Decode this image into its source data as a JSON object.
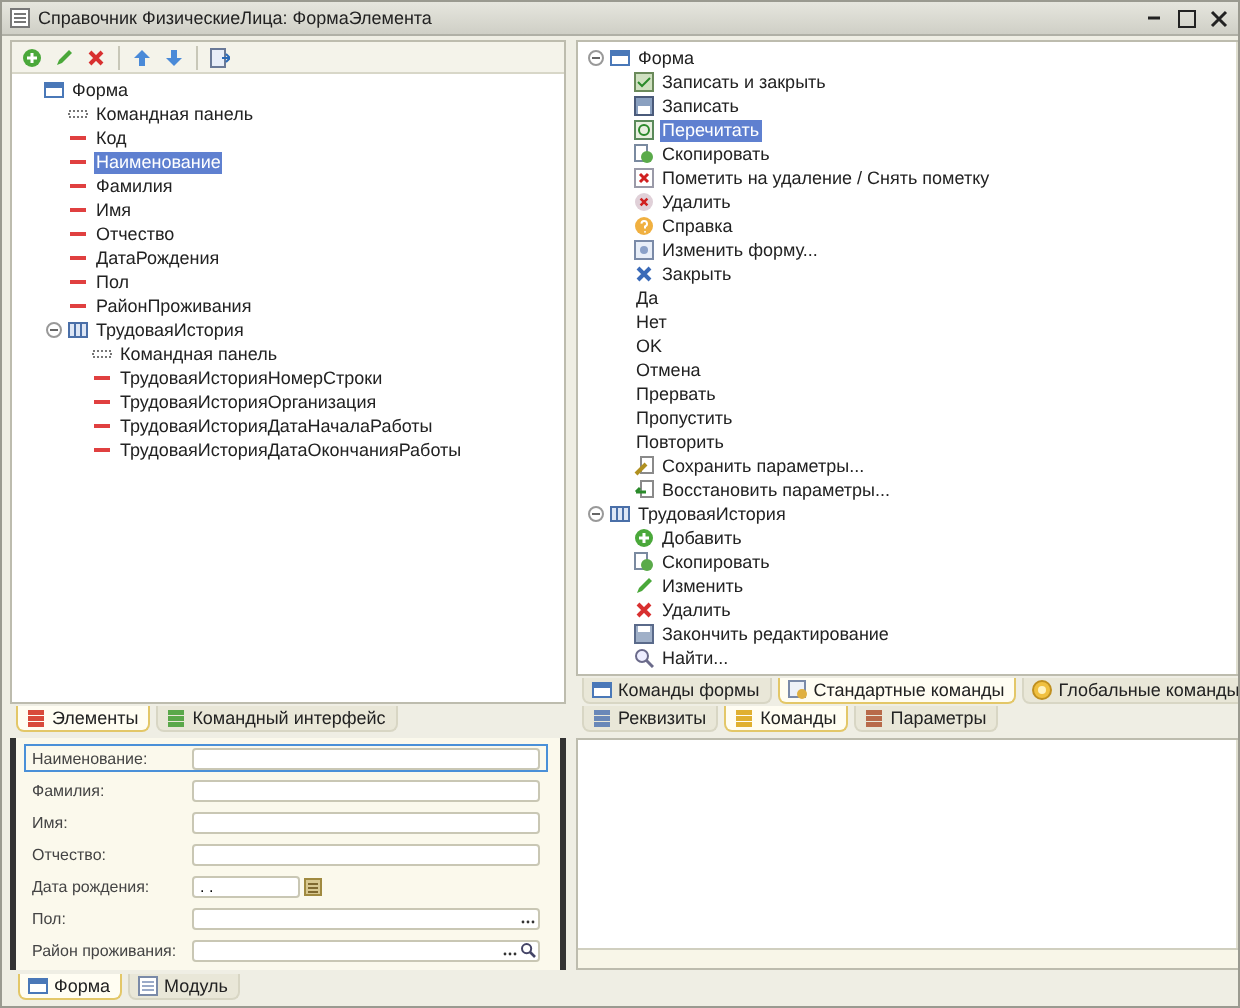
{
  "window": {
    "title": "Справочник ФизическиеЛица: ФормаЭлемента"
  },
  "toolbar": [
    {
      "kind": "add"
    },
    {
      "kind": "edit"
    },
    {
      "kind": "delete"
    },
    {
      "kind": "separator"
    },
    {
      "kind": "up"
    },
    {
      "kind": "down"
    },
    {
      "kind": "separator"
    },
    {
      "kind": "check"
    }
  ],
  "elements_tree": [
    {
      "label": "Форма",
      "kind": "form",
      "selected": false,
      "children": [
        {
          "label": "Командная панель",
          "kind": "panel",
          "selected": false
        },
        {
          "label": "Код",
          "kind": "field",
          "selected": false
        },
        {
          "label": "Наименование",
          "kind": "field",
          "selected": true
        },
        {
          "label": "Фамилия",
          "kind": "field",
          "selected": false
        },
        {
          "label": "Имя",
          "kind": "field",
          "selected": false
        },
        {
          "label": "Отчество",
          "kind": "field",
          "selected": false
        },
        {
          "label": "ДатаРождения",
          "kind": "field",
          "selected": false
        },
        {
          "label": "Пол",
          "kind": "field",
          "selected": false
        },
        {
          "label": "РайонПроживания",
          "kind": "field",
          "selected": false
        },
        {
          "label": "ТрудоваяИстория",
          "kind": "table",
          "selected": false,
          "expanded": true,
          "children": [
            {
              "label": "Командная панель",
              "kind": "panel",
              "selected": false
            },
            {
              "label": "ТрудоваяИсторияНомерСтроки",
              "kind": "field",
              "selected": false
            },
            {
              "label": "ТрудоваяИсторияОрганизация",
              "kind": "field",
              "selected": false
            },
            {
              "label": "ТрудоваяИсторияДатаНачалаРаботы",
              "kind": "field",
              "selected": false
            },
            {
              "label": "ТрудоваяИсторияДатаОкончанияРаботы",
              "kind": "field",
              "selected": false
            }
          ]
        }
      ]
    }
  ],
  "left_tabs": [
    {
      "label": "Элементы",
      "kind": "red",
      "selected": true
    },
    {
      "label": "Командный интерфейс",
      "kind": "green",
      "selected": false
    }
  ],
  "commands_tree": [
    {
      "label": "Форма",
      "kind": "form",
      "selected": false,
      "expanded": true,
      "children": [
        {
          "label": "Записать и закрыть",
          "kind": "save-close",
          "selected": false
        },
        {
          "label": "Записать",
          "kind": "save",
          "selected": false
        },
        {
          "label": "Перечитать",
          "kind": "reread",
          "selected": true
        },
        {
          "label": "Скопировать",
          "kind": "copy",
          "selected": false
        },
        {
          "label": "Пометить на удаление / Снять пометку",
          "kind": "mark-delete",
          "selected": false
        },
        {
          "label": "Удалить",
          "kind": "delete-round",
          "selected": false
        },
        {
          "label": "Справка",
          "kind": "help",
          "selected": false
        },
        {
          "label": "Изменить форму...",
          "kind": "edit-form",
          "selected": false
        },
        {
          "label": "Закрыть",
          "kind": "close",
          "selected": false
        },
        {
          "label": "Да",
          "kind": "none",
          "selected": false
        },
        {
          "label": "Нет",
          "kind": "none",
          "selected": false
        },
        {
          "label": "OK",
          "kind": "none",
          "selected": false
        },
        {
          "label": "Отмена",
          "kind": "none",
          "selected": false
        },
        {
          "label": "Прервать",
          "kind": "none",
          "selected": false
        },
        {
          "label": "Пропустить",
          "kind": "none",
          "selected": false
        },
        {
          "label": "Повторить",
          "kind": "none",
          "selected": false
        },
        {
          "label": "Сохранить параметры...",
          "kind": "save-params",
          "selected": false
        },
        {
          "label": "Восстановить параметры...",
          "kind": "restore-params",
          "selected": false
        }
      ]
    },
    {
      "label": "ТрудоваяИстория",
      "kind": "table",
      "selected": false,
      "expanded": true,
      "children": [
        {
          "label": "Добавить",
          "kind": "add",
          "selected": false
        },
        {
          "label": "Скопировать",
          "kind": "copy",
          "selected": false
        },
        {
          "label": "Изменить",
          "kind": "edit",
          "selected": false
        },
        {
          "label": "Удалить",
          "kind": "delete",
          "selected": false
        },
        {
          "label": "Закончить редактирование",
          "kind": "end-edit",
          "selected": false
        },
        {
          "label": "Найти...",
          "kind": "find",
          "selected": false
        }
      ]
    }
  ],
  "command_tabs": [
    {
      "label": "Команды формы",
      "kind": "form",
      "selected": false
    },
    {
      "label": "Стандартные команды",
      "kind": "standard",
      "selected": true
    },
    {
      "label": "Глобальные команды",
      "kind": "global",
      "selected": false
    }
  ],
  "data_tabs": [
    {
      "label": "Реквизиты",
      "kind": "blue",
      "selected": false
    },
    {
      "label": "Команды",
      "kind": "yellow",
      "selected": true
    },
    {
      "label": "Параметры",
      "kind": "brown",
      "selected": false
    }
  ],
  "form_preview": {
    "fields": [
      {
        "label": "Наименование:",
        "kind": "text",
        "selected": true
      },
      {
        "label": "Фамилия:",
        "kind": "text",
        "selected": false
      },
      {
        "label": "Имя:",
        "kind": "text",
        "selected": false
      },
      {
        "label": "Отчество:",
        "kind": "text",
        "selected": false
      },
      {
        "label": "Дата рождения:",
        "kind": "date",
        "value": ". .",
        "selected": false
      },
      {
        "label": "Пол:",
        "kind": "choice",
        "selected": false
      },
      {
        "label": "Район проживания:",
        "kind": "lookup",
        "selected": false
      }
    ]
  },
  "bottom_tabs": [
    {
      "label": "Форма",
      "kind": "form",
      "selected": true
    },
    {
      "label": "Модуль",
      "kind": "module",
      "selected": false
    }
  ]
}
